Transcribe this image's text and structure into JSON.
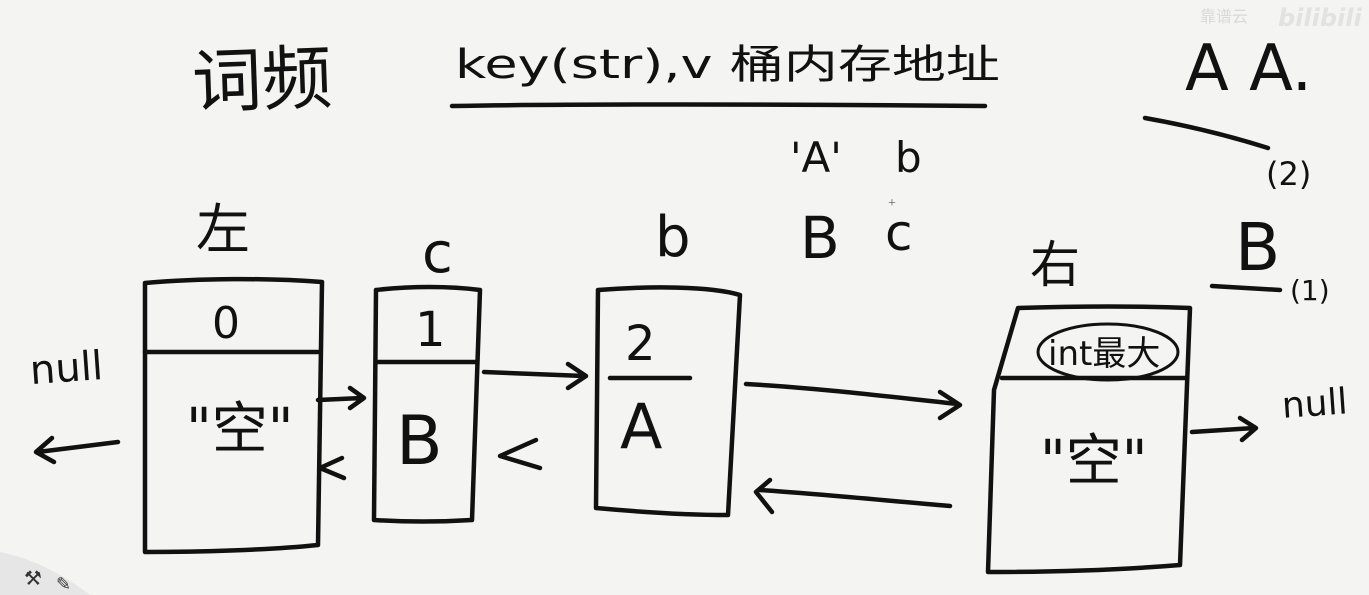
{
  "title": "词频",
  "header_annotation": "key(str),v 桶内存地址",
  "sub_annotation_a": "'A'",
  "sub_annotation_b": "b",
  "annotation_b_top": "b",
  "annotation_B": "B",
  "annotation_c": "c",
  "right_AA": "A A.",
  "right_count_2": "(2)",
  "right_B": "B",
  "right_count_1": "(1)",
  "left_null": "null",
  "right_null": "null",
  "buckets": [
    {
      "header": "左",
      "index": "0",
      "content": "\"空\""
    },
    {
      "header": "c",
      "index": "1",
      "content": "B"
    },
    {
      "header": "b",
      "index": "2",
      "content": "A"
    },
    {
      "header": "右",
      "index": "int最大",
      "content": "\"空\""
    }
  ],
  "watermark": "靠谱云",
  "watermark_logo": "bilibili"
}
